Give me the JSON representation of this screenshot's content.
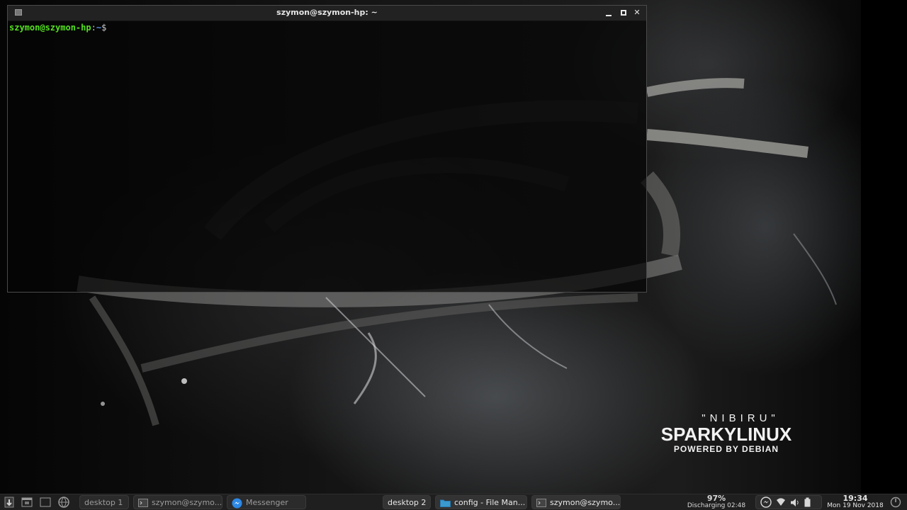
{
  "window": {
    "title": "szymon@szymon-hp: ~",
    "prompt_user": "szymon@szymon-hp",
    "prompt_sep": ":",
    "prompt_path": "~",
    "prompt_symbol": "$"
  },
  "wallpaper": {
    "subtitle": "\"NIBIRU\"",
    "brand": "SPARKYLINUX",
    "powered": "POWERED BY DEBIAN"
  },
  "taskbar": {
    "launchers": [
      {
        "icon": "sparky-menu-icon"
      },
      {
        "icon": "window-icon"
      },
      {
        "icon": "show-desktop-icon"
      },
      {
        "icon": "browser-globe-icon"
      }
    ],
    "tasks": [
      {
        "label": "desktop 1",
        "active": false
      },
      {
        "label": "szymon@szymo...",
        "icon": "terminal-icon",
        "active": false
      },
      {
        "label": "Messenger",
        "icon": "messenger-icon",
        "active": false
      },
      {
        "label": "desktop 2",
        "active": true
      },
      {
        "label": "config - File Man...",
        "icon": "folder-icon",
        "active": true
      },
      {
        "label": "szymon@szymo...",
        "icon": "terminal-icon",
        "active": true
      }
    ],
    "battery": {
      "percent": "97%",
      "status": "Discharging 02:48"
    },
    "tray_icons": [
      "messenger-tray-icon",
      "wifi-icon",
      "volume-icon",
      "battery-icon"
    ],
    "clock": {
      "time": "19:34",
      "date": "Mon 19 Nov 2018"
    },
    "power_icon": "power-icon"
  },
  "colors": {
    "prompt_user": "#55e020",
    "prompt_path": "#5a8fe0",
    "taskbar_bg": "#1f1f1f"
  }
}
